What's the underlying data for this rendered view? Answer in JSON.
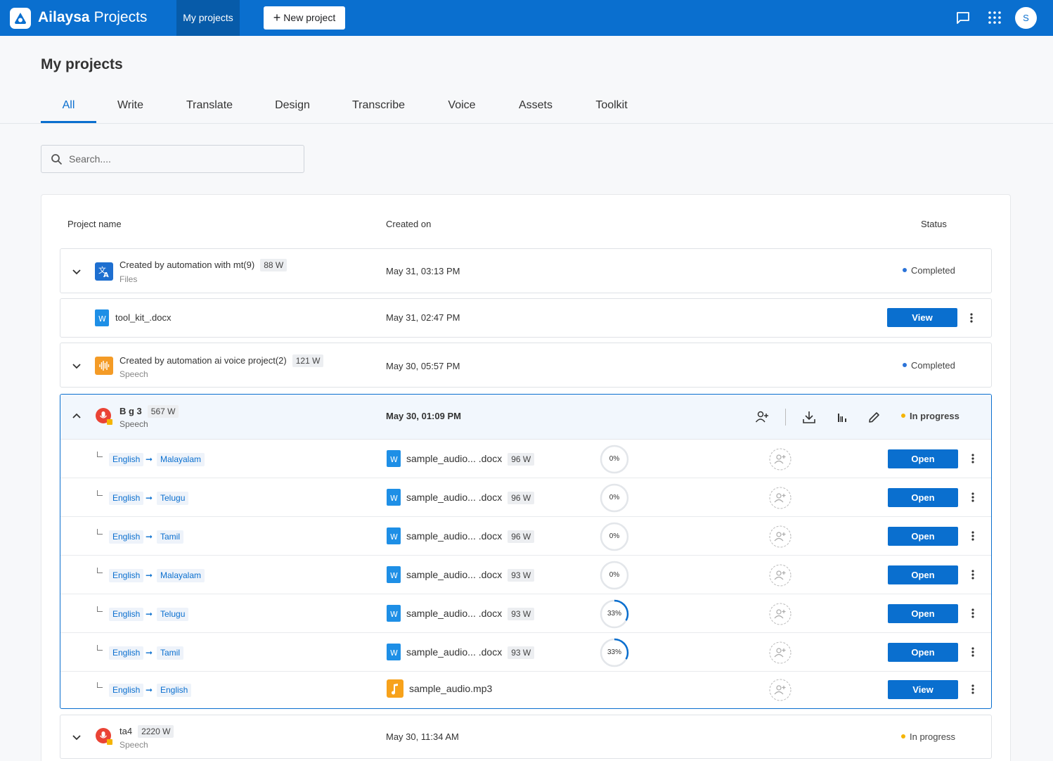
{
  "topbar": {
    "brand_name": "Ailaysa",
    "brand_product": "Projects",
    "nav_my_projects": "My projects",
    "new_project": "New project",
    "avatar_initial": "S",
    "icons": [
      "chat-icon",
      "apps-grid-icon"
    ]
  },
  "page": {
    "title": "My projects",
    "tabs": [
      "All",
      "Write",
      "Translate",
      "Design",
      "Transcribe",
      "Voice",
      "Assets",
      "Toolkit"
    ],
    "active_tab": "All",
    "search_placeholder": "Search...."
  },
  "table": {
    "headers": {
      "name": "Project name",
      "created": "Created on",
      "status": "Status"
    }
  },
  "projects": [
    {
      "name": "Created by automation with mt(9)",
      "words": "88 W",
      "sub": "Files",
      "date": "May 31, 03:13 PM",
      "status": "Completed",
      "status_color": "#2b73d8"
    },
    {
      "file": "tool_kit_.docx",
      "date": "May 31, 02:47 PM",
      "action": "View"
    },
    {
      "name": "Created by automation ai voice project(2)",
      "words": "121 W",
      "sub": "Speech",
      "date": "May 30, 05:57 PM",
      "status": "Completed",
      "status_color": "#2b73d8"
    },
    {
      "name": "B g 3",
      "words": "567 W",
      "sub": "Speech",
      "date": "May 30, 01:09 PM",
      "status": "In progress",
      "status_color": "#f5b400"
    },
    {
      "name": "ta4",
      "words": "2220 W",
      "sub": "Speech",
      "date": "May 30, 11:34 AM",
      "status": "In progress",
      "status_color": "#f5b400"
    }
  ],
  "tasks": [
    {
      "src": "English",
      "tgt": "Malayalam",
      "file": "sample_audio... .docx",
      "words": "96 W",
      "progress": 0,
      "progress_label": "0%",
      "action": "Open"
    },
    {
      "src": "English",
      "tgt": "Telugu",
      "file": "sample_audio... .docx",
      "words": "96 W",
      "progress": 0,
      "progress_label": "0%",
      "action": "Open"
    },
    {
      "src": "English",
      "tgt": "Tamil",
      "file": "sample_audio... .docx",
      "words": "96 W",
      "progress": 0,
      "progress_label": "0%",
      "action": "Open"
    },
    {
      "src": "English",
      "tgt": "Malayalam",
      "file": "sample_audio... .docx",
      "words": "93 W",
      "progress": 0,
      "progress_label": "0%",
      "action": "Open"
    },
    {
      "src": "English",
      "tgt": "Telugu",
      "file": "sample_audio... .docx",
      "words": "93 W",
      "progress": 33,
      "progress_label": "33%",
      "action": "Open"
    },
    {
      "src": "English",
      "tgt": "Tamil",
      "file": "sample_audio... .docx",
      "words": "93 W",
      "progress": 33,
      "progress_label": "33%",
      "action": "Open"
    },
    {
      "src": "English",
      "tgt": "English",
      "file": "sample_audio.mp3",
      "words": "",
      "progress": null,
      "progress_label": "",
      "action": "View"
    }
  ],
  "colors": {
    "primary": "#0a6fcf",
    "completed_dot": "#2b73d8",
    "progress_dot": "#f5b400"
  }
}
